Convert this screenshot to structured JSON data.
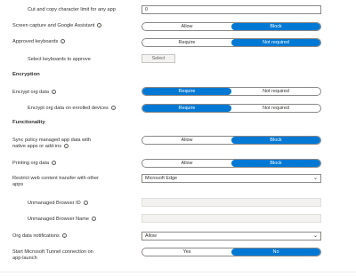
{
  "rows": {
    "cut_copy": {
      "label": "Cut and copy character limit for any app",
      "value": "0"
    },
    "screen_capture": {
      "label": "Screen capture and Google Assistant",
      "opt1": "Allow",
      "opt2": "Block"
    },
    "approved_keyboards": {
      "label": "Approved keyboards",
      "opt1": "Require",
      "opt2": "Not required"
    },
    "select_keyboards": {
      "label": "Select keyboards to approve",
      "button": "Select"
    },
    "encryption_header": "Encryption",
    "encrypt_org": {
      "label": "Encrypt org data",
      "opt1": "Require",
      "opt2": "Not required"
    },
    "encrypt_enrolled": {
      "label": "Encrypt org data on enrolled devices",
      "opt1": "Require",
      "opt2": "Not required"
    },
    "functionality_header": "Functionality",
    "sync_policy": {
      "label_line1": "Sync policy managed app data with",
      "label_line2": "native apps or add-ins",
      "opt1": "Allow",
      "opt2": "Block"
    },
    "printing": {
      "label": "Printing org data",
      "opt1": "Allow",
      "opt2": "Block"
    },
    "restrict_web": {
      "label_line1": "Restrict web content transfer with other",
      "label_line2": "apps",
      "value": "Microsoft Edge"
    },
    "unmanaged_id": {
      "label": "Unmanaged Browser ID"
    },
    "unmanaged_name": {
      "label": "Unmanaged Browser Name"
    },
    "org_notifications": {
      "label": "Org data notifications",
      "value": "Allow"
    },
    "tunnel": {
      "label_line1": "Start Microsoft Tunnel connection on",
      "label_line2": "app-launch",
      "opt1": "Yes",
      "opt2": "No"
    }
  },
  "icons": {
    "info": "info-icon",
    "chevron": "chevron-down-icon"
  },
  "colors": {
    "accent": "#0078d4"
  }
}
